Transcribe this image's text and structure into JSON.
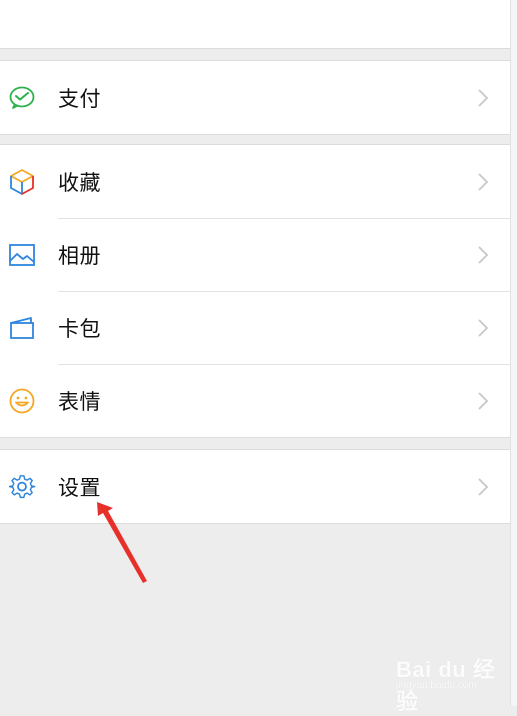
{
  "menu": {
    "pay": {
      "label": "支付",
      "icon": "wechat-pay-icon"
    },
    "favorites": {
      "label": "收藏",
      "icon": "cube-icon"
    },
    "album": {
      "label": "相册",
      "icon": "image-icon"
    },
    "cards": {
      "label": "卡包",
      "icon": "wallet-icon"
    },
    "stickers": {
      "label": "表情",
      "icon": "smiley-icon"
    },
    "settings": {
      "label": "设置",
      "icon": "gear-icon"
    }
  },
  "annotation": {
    "color": "#e8302a"
  },
  "watermark": {
    "main": "Bai du 经验",
    "sub": "jingyan.baidu.com"
  },
  "colors": {
    "background": "#ededed",
    "green": "#2bb24c",
    "blue": "#2e86de",
    "orange": "#f5a623",
    "chevron": "#c7c7cc"
  }
}
